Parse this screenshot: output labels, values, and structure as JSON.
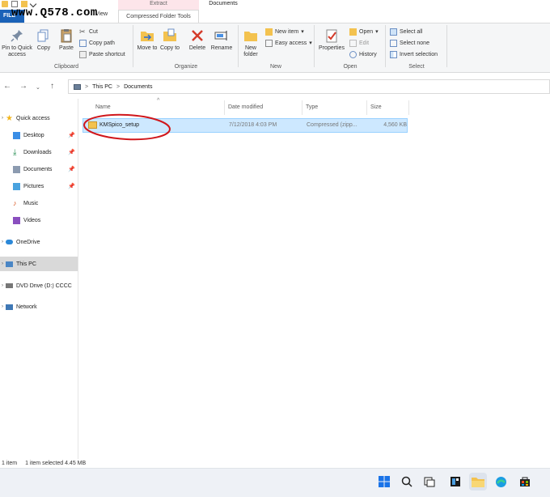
{
  "watermark": "www.Q578.com",
  "ribbon_tabs": {
    "file": "FILE",
    "view": "View",
    "context_group": "Extract",
    "context_tab": "Compressed Folder Tools",
    "window_title": "Documents"
  },
  "ribbon": {
    "clipboard": {
      "pin_quick_access": "Pin to Quick access",
      "copy": "Copy",
      "paste": "Paste",
      "cut": "Cut",
      "copy_path": "Copy path",
      "paste_shortcut": "Paste shortcut",
      "label": "Clipboard"
    },
    "organize": {
      "move_to": "Move to",
      "copy_to": "Copy to",
      "delete": "Delete",
      "rename": "Rename",
      "label": "Organize"
    },
    "new": {
      "new_folder": "New folder",
      "new_item": "New item",
      "easy_access": "Easy access",
      "label": "New"
    },
    "open": {
      "properties": "Properties",
      "open": "Open",
      "edit": "Edit",
      "history": "History",
      "label": "Open"
    },
    "select": {
      "select_all": "Select all",
      "select_none": "Select none",
      "invert_selection": "Invert selection",
      "label": "Select"
    }
  },
  "address": {
    "segments": [
      "This PC",
      "Documents"
    ],
    "separator": ">"
  },
  "sidebar": {
    "items": [
      {
        "label": "Quick access",
        "icon": "star-icon"
      },
      {
        "label": "Desktop",
        "icon": "desktop-icon"
      },
      {
        "label": "Downloads",
        "icon": "download-icon"
      },
      {
        "label": "Documents",
        "icon": "documents-icon"
      },
      {
        "label": "Pictures",
        "icon": "pictures-icon"
      },
      {
        "label": "Music",
        "icon": "music-icon"
      },
      {
        "label": "Videos",
        "icon": "videos-icon"
      },
      {
        "label": "OneDrive",
        "icon": "cloud-icon"
      },
      {
        "label": "This PC",
        "icon": "computer-icon"
      },
      {
        "label": "DVD Drive (D:) CCCC",
        "icon": "dvd-icon"
      },
      {
        "label": "Network",
        "icon": "network-icon"
      }
    ]
  },
  "columns": {
    "name": "Name",
    "date": "Date modified",
    "type": "Type",
    "size": "Size"
  },
  "files": [
    {
      "name": "KMSpico_setup",
      "date": "7/12/2018 4:03 PM",
      "type": "Compressed (zipp...",
      "size": "4,560 KB"
    }
  ],
  "status": {
    "count": "1 item",
    "selected": "1 item selected  4.45 MB"
  },
  "colors": {
    "accent": "#1a62b8",
    "selection": "#cde8ff",
    "annotation": "#d0161b"
  }
}
